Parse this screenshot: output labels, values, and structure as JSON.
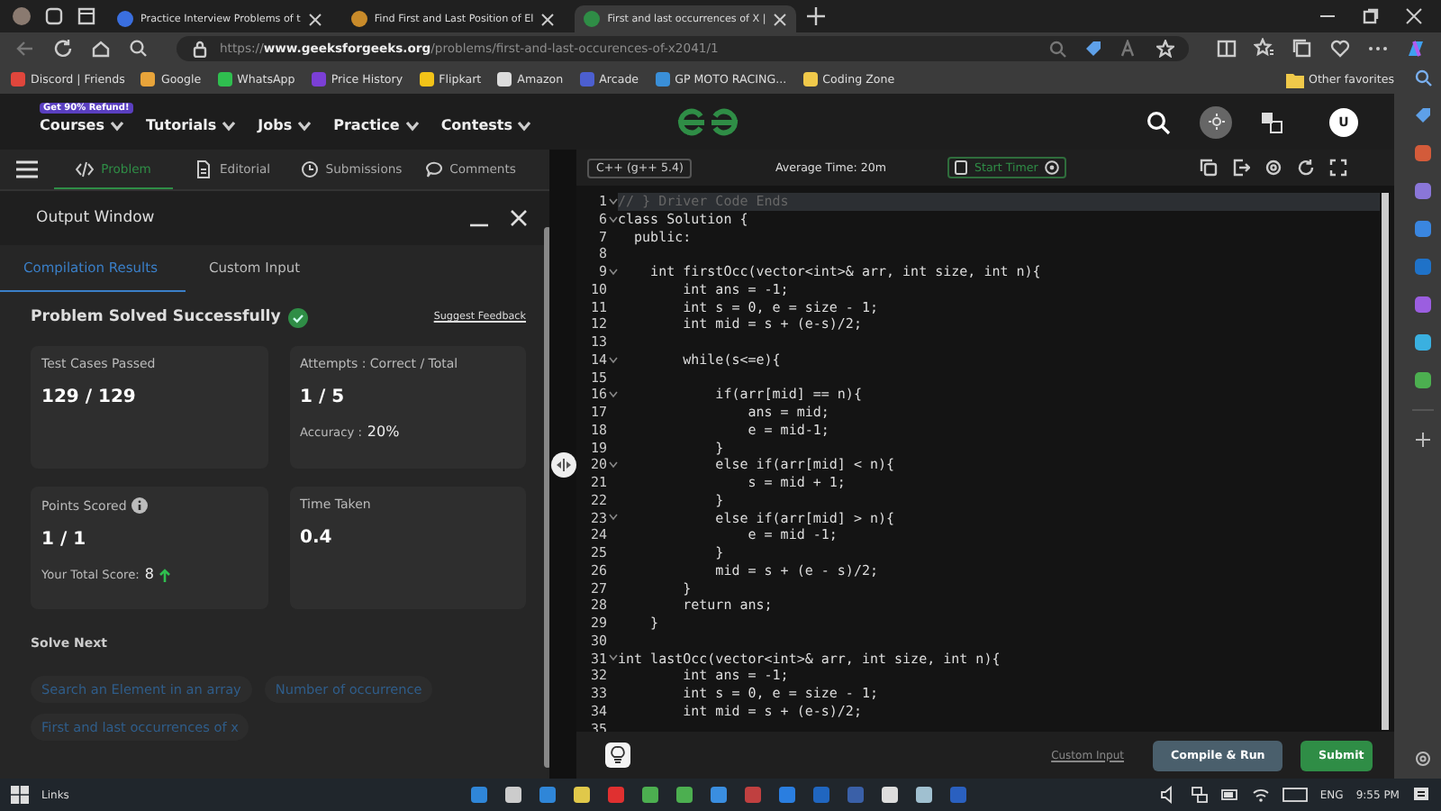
{
  "browser": {
    "tabs": [
      {
        "title": "Practice Interview Problems of t",
        "selected": false
      },
      {
        "title": "Find First and Last Position of El",
        "selected": false
      },
      {
        "title": "First and last occurrences of X |",
        "selected": true
      }
    ],
    "address": {
      "scheme": "https://",
      "domain": "www.geeksforgeeks.org",
      "path": "/problems/first-and-last-occurences-of-x2041/1"
    },
    "bookmarks": [
      {
        "label": "Discord | Friends",
        "color": "#e0463c"
      },
      {
        "label": "Google",
        "color": "#e8a43a"
      },
      {
        "label": "WhatsApp",
        "color": "#2fbf4f"
      },
      {
        "label": "Price History",
        "color": "#7b3fd6"
      },
      {
        "label": "Flipkart",
        "color": "#f2c318"
      },
      {
        "label": "Amazon",
        "color": "#dddddd"
      },
      {
        "label": "Arcade",
        "color": "#4c5fd0"
      },
      {
        "label": "GP MOTO RACING...",
        "color": "#3a8fd8"
      },
      {
        "label": "Coding Zone",
        "color": "#f0c94a"
      }
    ],
    "other_favorites": "Other favorites"
  },
  "navbar": {
    "badge": "Get 90% Refund!",
    "menu": [
      "Courses",
      "Tutorials",
      "Jobs",
      "Practice",
      "Contests"
    ],
    "avatar": "U"
  },
  "problem_tabs": [
    {
      "label": "Problem",
      "kind": "code",
      "selected": true
    },
    {
      "label": "Editorial",
      "kind": "doc",
      "selected": false
    },
    {
      "label": "Submissions",
      "kind": "clock",
      "selected": false
    },
    {
      "label": "Comments",
      "kind": "chat",
      "selected": false
    }
  ],
  "output_window": {
    "title": "Output Window",
    "tabs": [
      {
        "label": "Compilation Results",
        "selected": true
      },
      {
        "label": "Custom Input",
        "selected": false
      }
    ],
    "status": "Problem Solved Successfully",
    "feedback_link": "Suggest Feedback",
    "stats": [
      {
        "label": "Test Cases Passed",
        "value": "129 / 129"
      },
      {
        "label": "Attempts : Correct / Total",
        "value": "1 / 5",
        "note_label": "Accuracy :",
        "note_value": "20%"
      },
      {
        "label": "Points Scored",
        "info": true,
        "value": "1 / 1",
        "note_label": "Your Total Score:",
        "note_value": "8",
        "trend_up": true
      },
      {
        "label": "Time Taken",
        "value": "0.4"
      }
    ],
    "solve_next": {
      "title": "Solve Next",
      "items": [
        "Search an Element in an array",
        "Number of occurrence",
        "First and last occurrences of x"
      ]
    }
  },
  "editor": {
    "language": "C++ (g++ 5.4)",
    "average_time": "Average Time: 20m",
    "timer_button": "Start Timer",
    "lines": [
      {
        "number": "1",
        "code": "// } Driver Code Ends",
        "fold": true,
        "active": true
      },
      {
        "number": "6",
        "code": "class Solution {",
        "fold": true,
        "active": false
      },
      {
        "number": "7",
        "code": "  public:",
        "fold": false,
        "active": false
      },
      {
        "number": "8",
        "fold": false,
        "active": false
      },
      {
        "number": "9",
        "code": "    int firstOcc(vector<int>& arr, int size, int n){",
        "fold": true,
        "active": false
      },
      {
        "number": "10",
        "code": "        int ans = -1;",
        "fold": false,
        "active": false
      },
      {
        "number": "11",
        "code": "        int s = 0, e = size - 1;",
        "fold": false,
        "active": false
      },
      {
        "number": "12",
        "code": "        int mid = s + (e-s)/2;",
        "fold": false,
        "active": false
      },
      {
        "number": "13",
        "fold": false,
        "active": false
      },
      {
        "number": "14",
        "code": "        while(s<=e){",
        "fold": true,
        "active": false
      },
      {
        "number": "15",
        "fold": false,
        "active": false
      },
      {
        "number": "16",
        "code": "            if(arr[mid] == n){",
        "fold": true,
        "active": false
      },
      {
        "number": "17",
        "code": "                ans = mid;",
        "fold": false,
        "active": false
      },
      {
        "number": "18",
        "code": "                e = mid-1;",
        "fold": false,
        "active": false
      },
      {
        "number": "19",
        "code": "            }",
        "fold": false,
        "active": false
      },
      {
        "number": "20",
        "code": "            else if(arr[mid] < n){",
        "fold": true,
        "active": false
      },
      {
        "number": "21",
        "code": "                s = mid + 1;",
        "fold": false,
        "active": false
      },
      {
        "number": "22",
        "code": "            }",
        "fold": false,
        "active": false
      },
      {
        "number": "23",
        "code": "            else if(arr[mid] > n){",
        "fold": true,
        "active": false
      },
      {
        "number": "24",
        "code": "                e = mid -1;",
        "fold": false,
        "active": false
      },
      {
        "number": "25",
        "code": "            }",
        "fold": false,
        "active": false
      },
      {
        "number": "26",
        "code": "            mid = s + (e - s)/2;",
        "fold": false,
        "active": false
      },
      {
        "number": "27",
        "code": "        }",
        "fold": false,
        "active": false
      },
      {
        "number": "28",
        "code": "        return ans;",
        "fold": false,
        "active": false
      },
      {
        "number": "29",
        "code": "    }",
        "fold": false,
        "active": false
      },
      {
        "number": "30",
        "fold": false,
        "active": false
      },
      {
        "number": "31",
        "code": "int lastOcc(vector<int>& arr, int size, int n){",
        "fold": true,
        "active": false
      },
      {
        "number": "32",
        "code": "        int ans = -1;",
        "fold": false,
        "active": false
      },
      {
        "number": "33",
        "code": "        int s = 0, e = size - 1;",
        "fold": false,
        "active": false
      },
      {
        "number": "34",
        "code": "        int mid = s + (e-s)/2;",
        "fold": false,
        "active": false
      },
      {
        "number": "35",
        "fold": false,
        "active": false
      }
    ],
    "custom_input": "Custom Input",
    "buttons": [
      {
        "label": "Compile & Run",
        "kind": "secondary"
      },
      {
        "label": "Submit",
        "kind": "primary"
      }
    ]
  },
  "taskbar": {
    "search_label": "Links",
    "language": "ENG",
    "time": "9:55 PM"
  }
}
